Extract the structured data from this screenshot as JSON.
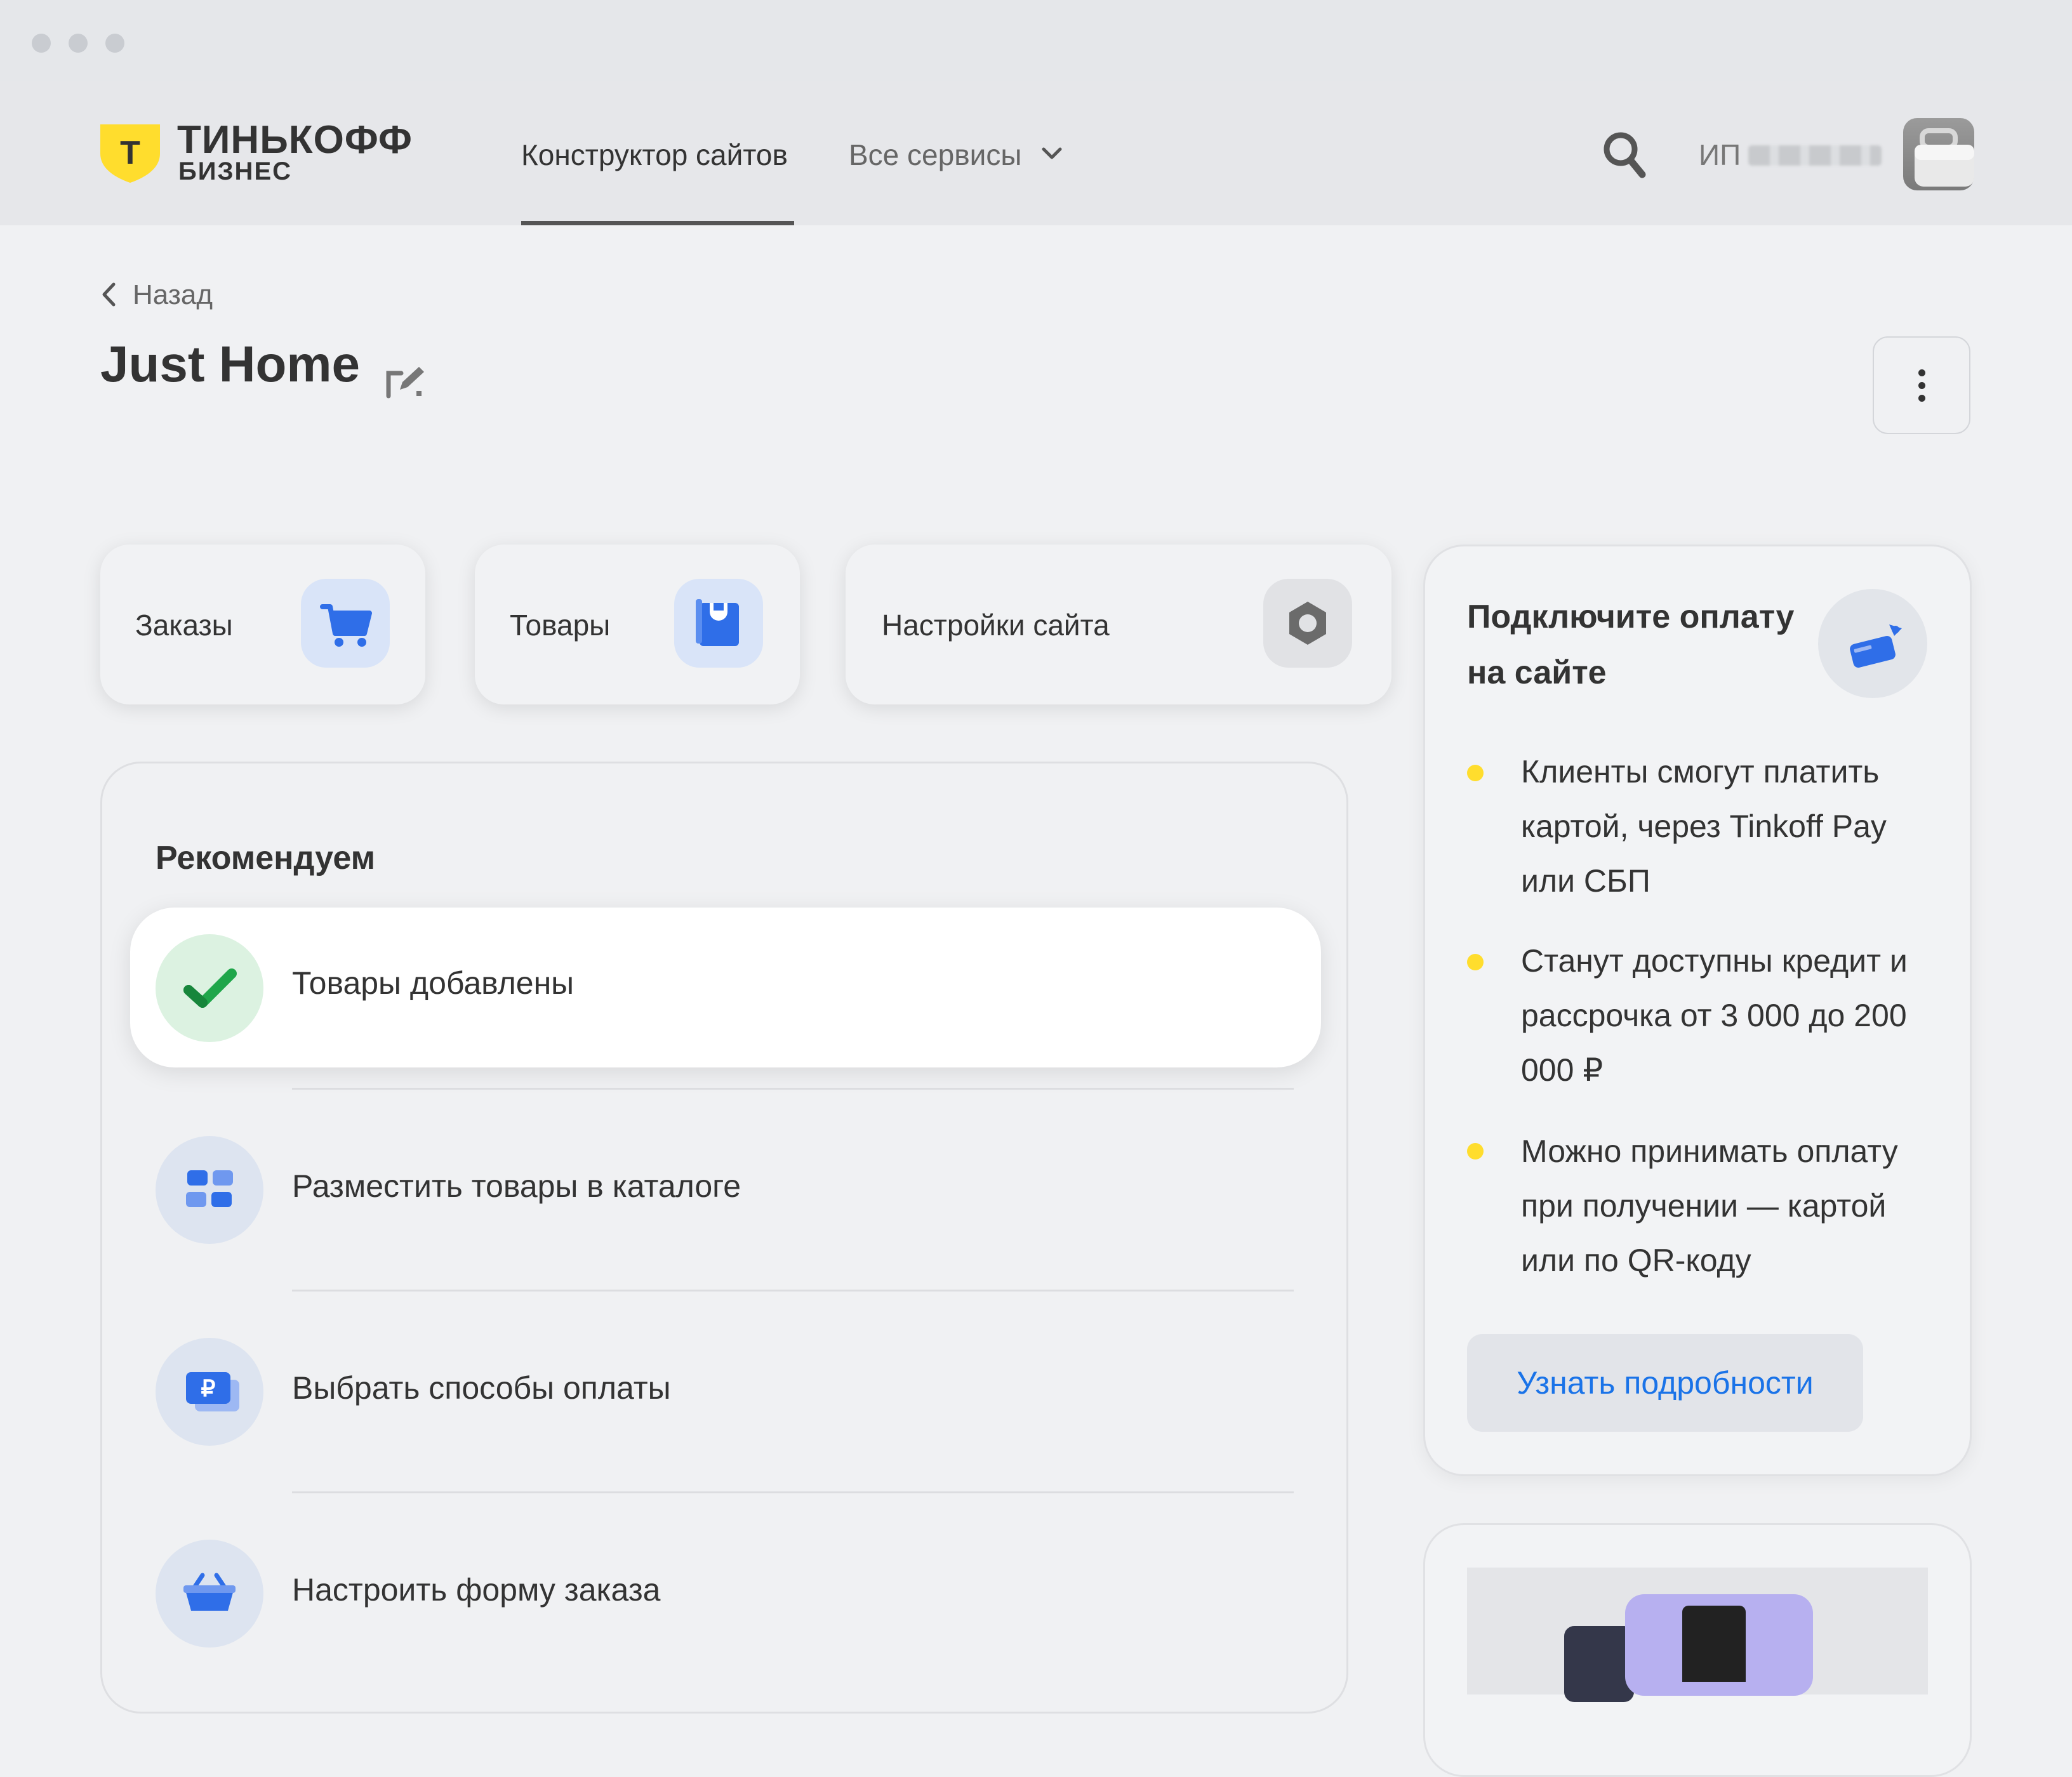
{
  "header": {
    "logo_line1": "ТИНЬКОФФ",
    "logo_line2": "БИЗНЕС",
    "logo_badge": "Т",
    "nav": [
      {
        "label": "Конструктор сайтов",
        "active": true
      },
      {
        "label": "Все сервисы",
        "active": false
      }
    ],
    "user_prefix": "ИП"
  },
  "page": {
    "back_label": "Назад",
    "title": "Just Home"
  },
  "quick_cards": [
    {
      "label": "Заказы",
      "icon": "cart-icon"
    },
    {
      "label": "Товары",
      "icon": "shopping-bag-icon"
    },
    {
      "label": "Настройки сайта",
      "icon": "nut-icon"
    }
  ],
  "recommend": {
    "title": "Рекомендуем",
    "items": [
      {
        "label": "Товары добавлены",
        "icon": "check-icon",
        "done": true
      },
      {
        "label": "Разместить товары в каталоге",
        "icon": "grid-icon",
        "done": false
      },
      {
        "label": "Выбрать способы оплаты",
        "icon": "ruble-card-icon",
        "done": false
      },
      {
        "label": "Настроить форму заказа",
        "icon": "basket-icon",
        "done": false
      }
    ]
  },
  "payment_card": {
    "title": "Подключите оплату на сайте",
    "bullets": [
      "Клиенты смогут платить картой, через Tinkoff Pay или СБП",
      "Станут доступны кредит и рассрочка от 3 000 до 200 000 ₽",
      "Можно принимать оплату при получении — картой или по QR-коду"
    ],
    "button": "Узнать подробности"
  },
  "colors": {
    "accent_yellow": "#ffdd2d",
    "link_blue": "#1a73e8",
    "icon_blue": "#2f6ee8",
    "success_green": "#1fa64a"
  }
}
